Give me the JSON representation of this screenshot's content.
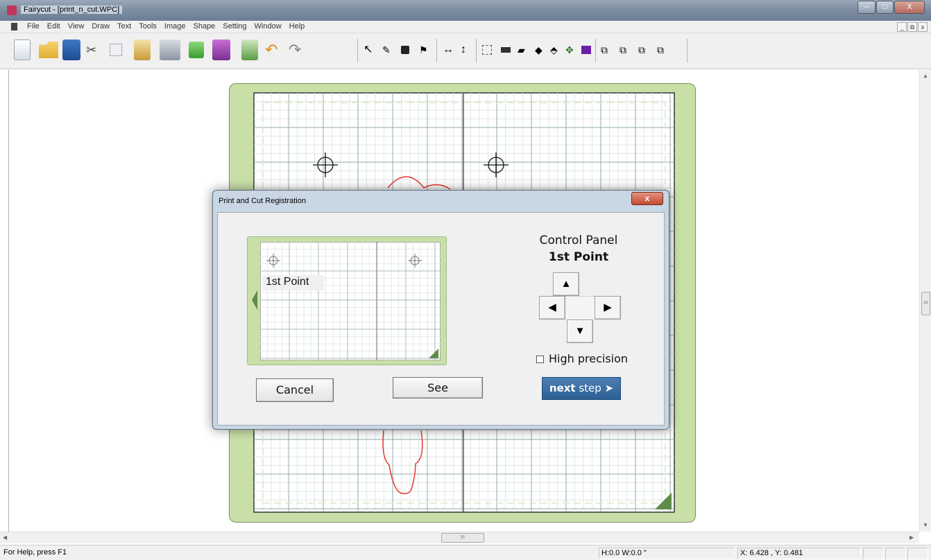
{
  "window": {
    "title": "Fairycut - [print_n_cut.WPC]",
    "minimize_label": "–",
    "maximize_label": "□",
    "close_label": "X"
  },
  "menu": {
    "items": [
      "File",
      "Edit",
      "View",
      "Draw",
      "Text",
      "Tools",
      "Image",
      "Shape",
      "Setting",
      "Window",
      "Help"
    ],
    "mdi_minimize": "_",
    "mdi_restore": "⧉",
    "mdi_close": "x"
  },
  "toolbar": {
    "icons": [
      "new-file-icon",
      "open-folder-icon",
      "save-disk-icon",
      "cut-scissors-icon",
      "copy-icon",
      "paste-icon",
      "print-icon",
      "refresh-icon",
      "library-book-icon",
      "import-icon",
      "undo-icon",
      "redo-icon",
      "select-arrow-icon",
      "node-edit-icon",
      "fill-icon",
      "weld-icon",
      "flip-horizontal-icon",
      "flip-vertical-icon",
      "group-icon",
      "rectangle-icon",
      "eraser-icon",
      "bucket-icon",
      "shape-icon",
      "move-icon",
      "color-icon",
      "align-1-icon",
      "align-2-icon",
      "align-3-icon",
      "align-4-icon"
    ]
  },
  "scroll": {
    "up": "▲",
    "down": "▼",
    "left": "◀",
    "right": "▶",
    "grip": "III"
  },
  "status": {
    "help": "For Help, press F1",
    "size": "H:0.0  W:0.0 \"",
    "coords": "X: 6.428 , Y: 0.481"
  },
  "dialog": {
    "title": "Print and Cut Registration",
    "close_label": "x",
    "preview_label": "1st Point",
    "control_panel_title": "Control Panel",
    "control_panel_point": "1st Point",
    "arrow_up": "▲",
    "arrow_left": "◀",
    "arrow_right": "▶",
    "arrow_down": "▼",
    "high_precision_label": "High precision",
    "high_precision_checked": false,
    "cancel_label": "Cancel",
    "see_label": "See",
    "next_label_bold": "next",
    "next_label_rest": "step",
    "next_arrow": "➤"
  },
  "colors": {
    "mat_green": "#c8e0a8",
    "mat_triangle": "#5f8a47",
    "cut_path": "#e8352a",
    "next_button": "#3a6da3"
  }
}
